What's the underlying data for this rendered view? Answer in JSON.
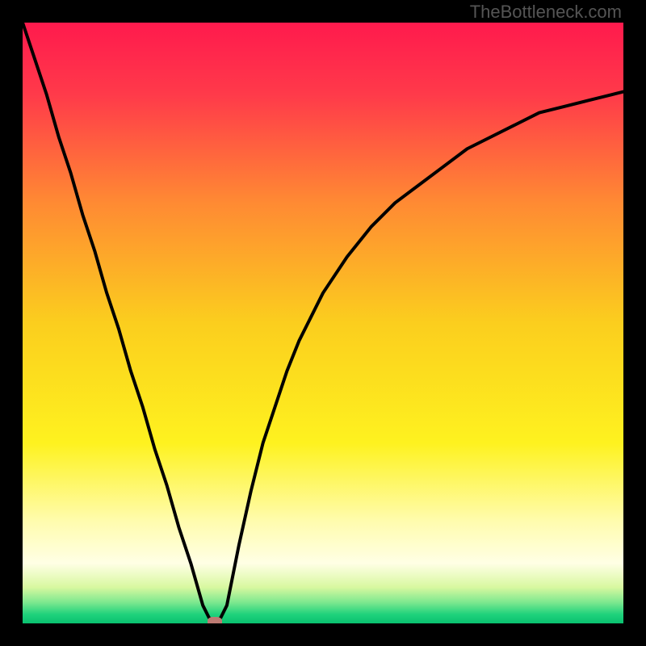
{
  "watermark": "TheBottleneck.com",
  "chart_data": {
    "type": "line",
    "title": "",
    "xlabel": "",
    "ylabel": "",
    "xlim": [
      0,
      100
    ],
    "ylim": [
      0,
      100
    ],
    "x": [
      0,
      2,
      4,
      6,
      8,
      10,
      12,
      14,
      16,
      18,
      20,
      22,
      24,
      26,
      28,
      30,
      31,
      32,
      33,
      34,
      35,
      36,
      38,
      40,
      42,
      44,
      46,
      48,
      50,
      54,
      58,
      62,
      66,
      70,
      74,
      78,
      82,
      86,
      90,
      94,
      98,
      100
    ],
    "values": [
      100,
      94,
      88,
      81,
      75,
      68,
      62,
      55,
      49,
      42,
      36,
      29,
      23,
      16,
      10,
      3,
      1,
      0,
      1,
      3,
      8,
      13,
      22,
      30,
      36,
      42,
      47,
      51,
      55,
      61,
      66,
      70,
      73,
      76,
      79,
      81,
      83,
      85,
      86,
      87,
      88,
      88.5
    ],
    "marker": {
      "x": 32,
      "y": 0
    },
    "background_gradient": {
      "stops": [
        {
          "pos": 0.0,
          "color": "#ff1a4d"
        },
        {
          "pos": 0.12,
          "color": "#ff3a4a"
        },
        {
          "pos": 0.3,
          "color": "#ff8a33"
        },
        {
          "pos": 0.5,
          "color": "#fbce1e"
        },
        {
          "pos": 0.7,
          "color": "#fef21f"
        },
        {
          "pos": 0.83,
          "color": "#fffcae"
        },
        {
          "pos": 0.9,
          "color": "#ffffe5"
        },
        {
          "pos": 0.94,
          "color": "#d8f8a0"
        },
        {
          "pos": 0.965,
          "color": "#7de88f"
        },
        {
          "pos": 0.985,
          "color": "#1fd27c"
        },
        {
          "pos": 1.0,
          "color": "#09c06f"
        }
      ]
    }
  }
}
